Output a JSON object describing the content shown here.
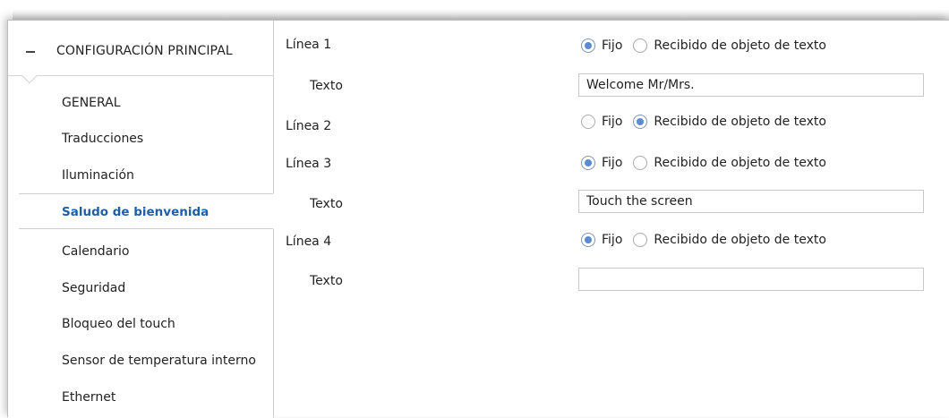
{
  "sidebar": {
    "section_title": "CONFIGURACIÓN PRINCIPAL",
    "items": [
      {
        "label": "GENERAL"
      },
      {
        "label": "Traducciones"
      },
      {
        "label": "Iluminación"
      },
      {
        "label": "Saludo de bienvenida",
        "selected": true
      },
      {
        "label": "Calendario"
      },
      {
        "label": "Seguridad"
      },
      {
        "label": "Bloqueo del touch"
      },
      {
        "label": "Sensor de temperatura interno"
      },
      {
        "label": "Ethernet"
      }
    ]
  },
  "main": {
    "rows": [
      {
        "label": "Línea 1",
        "option_fixed": "Fijo",
        "option_object": "Recibido de objeto de texto",
        "selected": "Fijo"
      },
      {
        "label": "Texto",
        "value": "Welcome Mr/Mrs."
      },
      {
        "label": "Línea 2",
        "option_fixed": "Fijo",
        "option_object": "Recibido de objeto de texto",
        "selected": "Recibido de objeto de texto"
      },
      {
        "label": "Línea 3",
        "option_fixed": "Fijo",
        "option_object": "Recibido de objeto de texto",
        "selected": "Fijo"
      },
      {
        "label": "Texto",
        "value": "Touch the screen"
      },
      {
        "label": "Línea 4",
        "option_fixed": "Fijo",
        "option_object": "Recibido de objeto de texto",
        "selected": "Fijo"
      },
      {
        "label": "Texto",
        "value": ""
      }
    ]
  },
  "colors": {
    "selected_nav_text": "#1f5fa8",
    "radio_fill": "#5b8bd0"
  },
  "icons": {
    "collapse": "minus-icon"
  }
}
